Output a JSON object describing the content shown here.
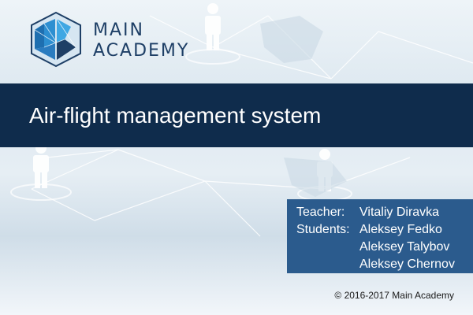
{
  "brand": {
    "line1": "MAIN",
    "line2": "ACADEMY",
    "logo_icon": "hexagon-network-logo-icon"
  },
  "title": "Air-flight management system",
  "credits": {
    "teacher_label": "Teacher:",
    "teacher": "Vitaliy Diravka",
    "students_label": "Students:",
    "students": [
      "Aleksey Fedko",
      "Aleksey Talybov",
      "Aleksey Chernov"
    ]
  },
  "footer": {
    "copyright": "© 2016-2017 Main Academy"
  },
  "colors": {
    "banner": "#0f2c4c",
    "info_box": "#2b5b8d",
    "brand_text": "#1e3f66",
    "logo_blue": "#2d8fd1"
  }
}
